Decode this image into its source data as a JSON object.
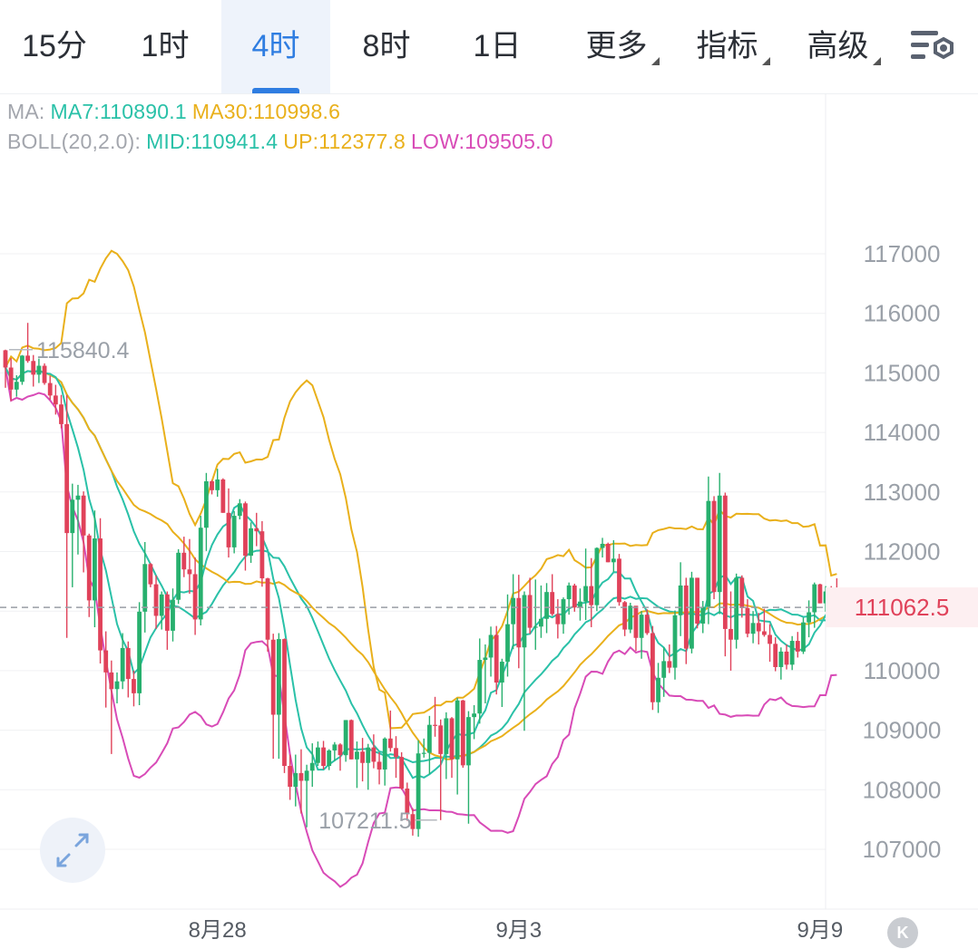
{
  "tabs": [
    {
      "label": "15分",
      "active": false
    },
    {
      "label": "1时",
      "active": false
    },
    {
      "label": "4时",
      "active": true
    },
    {
      "label": "8时",
      "active": false
    },
    {
      "label": "1日",
      "active": false
    },
    {
      "label": "更多",
      "active": false
    },
    {
      "label": "指标",
      "active": false
    },
    {
      "label": "高级",
      "active": false
    }
  ],
  "indicators": {
    "ma_label": "MA:",
    "ma7": "MA7:110890.1",
    "ma30": "MA30:110998.6",
    "boll_label": "BOLL(20,2.0):",
    "boll_mid": "MID:110941.4",
    "boll_up": "UP:112377.8",
    "boll_low": "LOW:109505.0"
  },
  "colors": {
    "up": "#27b06e",
    "down": "#e0425a",
    "ma7": "#2ac1a8",
    "ma30": "#e9b01b",
    "boll_mid": "#2ac1a8",
    "boll_up": "#e9b01b",
    "boll_low": "#d84bb7",
    "price_tag": "#e0425a",
    "axis_text": "#9aa0a8",
    "active_tab": "#2f7de1"
  },
  "chart_data": {
    "type": "candlestick",
    "y_ticks": [
      "117000",
      "116000",
      "115000",
      "114000",
      "113000",
      "112000",
      "111000",
      "110000",
      "109000",
      "108000",
      "107000"
    ],
    "ylim": [
      106300,
      117900
    ],
    "x_ticks": [
      {
        "label": "8月28",
        "index": 38
      },
      {
        "label": "9月3",
        "index": 92
      },
      {
        "label": "9月9",
        "index": 146
      }
    ],
    "current_price": "111062.5",
    "high_marker": {
      "label": "115840.4",
      "index": 0
    },
    "low_marker": {
      "label": "107211.5",
      "index": 78
    },
    "candles": [
      [
        115380,
        115390,
        114750,
        115090
      ],
      [
        115090,
        115250,
        114530,
        114720
      ],
      [
        114720,
        114960,
        114600,
        114850
      ],
      [
        114850,
        115300,
        114800,
        115290
      ],
      [
        115290,
        115840,
        115170,
        115200
      ],
      [
        115200,
        115300,
        114770,
        114970
      ],
      [
        114970,
        115240,
        114830,
        115120
      ],
      [
        115120,
        115160,
        114800,
        114830
      ],
      [
        114830,
        114950,
        114550,
        114620
      ],
      [
        114620,
        114800,
        114300,
        114470
      ],
      [
        114470,
        114630,
        114070,
        114140
      ],
      [
        114140,
        114630,
        110550,
        112310
      ],
      [
        112310,
        113140,
        111400,
        112870
      ],
      [
        112870,
        113120,
        111950,
        112940
      ],
      [
        112940,
        113010,
        111650,
        112270
      ],
      [
        112270,
        112300,
        110900,
        111180
      ],
      [
        111180,
        112690,
        110730,
        112220
      ],
      [
        112220,
        112560,
        110120,
        110340
      ],
      [
        110340,
        110660,
        109380,
        109970
      ],
      [
        109970,
        110170,
        108600,
        109690
      ],
      [
        109690,
        109970,
        109450,
        109820
      ],
      [
        109820,
        110630,
        109690,
        110380
      ],
      [
        110380,
        110490,
        109550,
        109860
      ],
      [
        109860,
        110000,
        109400,
        109620
      ],
      [
        109620,
        111150,
        109420,
        110990
      ],
      [
        110990,
        112160,
        110640,
        111790
      ],
      [
        111790,
        111810,
        111400,
        111450
      ],
      [
        111450,
        111600,
        110700,
        110920
      ],
      [
        110920,
        111330,
        110690,
        111280
      ],
      [
        111280,
        111330,
        110350,
        110670
      ],
      [
        110670,
        111380,
        110490,
        111190
      ],
      [
        111190,
        112040,
        111120,
        111980
      ],
      [
        111980,
        112250,
        111570,
        111700
      ],
      [
        111700,
        112210,
        111290,
        111620
      ],
      [
        111620,
        111900,
        110600,
        110860
      ],
      [
        110860,
        112600,
        110760,
        112400
      ],
      [
        112400,
        113320,
        112010,
        113180
      ],
      [
        113180,
        113200,
        112960,
        113030
      ],
      [
        113030,
        113390,
        112920,
        113210
      ],
      [
        113210,
        113230,
        112650,
        112650
      ],
      [
        112650,
        113060,
        111900,
        112070
      ],
      [
        112070,
        112680,
        111970,
        112600
      ],
      [
        112600,
        112880,
        112540,
        112810
      ],
      [
        112810,
        112840,
        111680,
        111930
      ],
      [
        111930,
        112490,
        111810,
        112390
      ],
      [
        112390,
        112650,
        112090,
        112340
      ],
      [
        112340,
        112510,
        111410,
        111550
      ],
      [
        111550,
        111560,
        110320,
        110520
      ],
      [
        110520,
        110620,
        108520,
        109260
      ],
      [
        109260,
        110630,
        108520,
        110530
      ],
      [
        110530,
        110540,
        108280,
        108400
      ],
      [
        108400,
        108590,
        107830,
        108050
      ],
      [
        108050,
        108590,
        107720,
        108280
      ],
      [
        108280,
        108680,
        107600,
        108150
      ],
      [
        108150,
        108420,
        107370,
        108320
      ],
      [
        108320,
        108780,
        108050,
        108450
      ],
      [
        108450,
        108810,
        108400,
        108710
      ],
      [
        108710,
        108820,
        108340,
        108400
      ],
      [
        108400,
        108680,
        108330,
        108660
      ],
      [
        108660,
        108800,
        108480,
        108760
      ],
      [
        108760,
        108780,
        108320,
        108580
      ],
      [
        108580,
        109170,
        108470,
        109170
      ],
      [
        109170,
        109180,
        108510,
        108510
      ],
      [
        108510,
        108810,
        108030,
        108640
      ],
      [
        108640,
        108870,
        108140,
        108450
      ],
      [
        108450,
        108770,
        108000,
        108710
      ],
      [
        108710,
        108930,
        108360,
        108470
      ],
      [
        108470,
        108630,
        108090,
        108340
      ],
      [
        108340,
        108880,
        108070,
        108860
      ],
      [
        108860,
        109330,
        108640,
        108700
      ],
      [
        108700,
        108900,
        108200,
        108550
      ],
      [
        108550,
        108630,
        108000,
        108020
      ],
      [
        108020,
        108120,
        107480,
        107590
      ],
      [
        107590,
        107690,
        107230,
        107340
      ],
      [
        107340,
        108830,
        107210,
        108610
      ],
      [
        108610,
        108860,
        108540,
        108620
      ],
      [
        108620,
        109240,
        108260,
        109090
      ],
      [
        109090,
        109560,
        108890,
        109080
      ],
      [
        109080,
        109180,
        107490,
        108600
      ],
      [
        108600,
        109300,
        108180,
        109200
      ],
      [
        109200,
        109220,
        108200,
        108510
      ],
      [
        108510,
        109540,
        107920,
        109500
      ],
      [
        109500,
        109510,
        108370,
        108410
      ],
      [
        108410,
        109320,
        107430,
        109220
      ],
      [
        109220,
        109420,
        108850,
        109280
      ],
      [
        109280,
        110540,
        109110,
        110180
      ],
      [
        110180,
        110440,
        109450,
        110220
      ],
      [
        110220,
        110740,
        109900,
        110600
      ],
      [
        110600,
        110750,
        109600,
        109800
      ],
      [
        109800,
        110200,
        109390,
        110150
      ],
      [
        110150,
        111280,
        109900,
        110780
      ],
      [
        110780,
        111620,
        110360,
        111220
      ],
      [
        111220,
        111610,
        110040,
        110390
      ],
      [
        110390,
        111330,
        108990,
        111270
      ],
      [
        111270,
        111560,
        110620,
        110720
      ],
      [
        110720,
        111530,
        110350,
        110740
      ],
      [
        110740,
        111430,
        110550,
        110870
      ],
      [
        110870,
        111470,
        110630,
        111320
      ],
      [
        111320,
        111620,
        110920,
        110950
      ],
      [
        110950,
        111200,
        110540,
        110780
      ],
      [
        110780,
        111230,
        110620,
        111200
      ],
      [
        111200,
        111480,
        110940,
        111430
      ],
      [
        111430,
        111460,
        110990,
        111060
      ],
      [
        111060,
        111380,
        110840,
        111160
      ],
      [
        111160,
        112050,
        110850,
        111420
      ],
      [
        111420,
        111890,
        110730,
        111100
      ],
      [
        111100,
        112070,
        111000,
        112060
      ],
      [
        112060,
        112230,
        111900,
        112130
      ],
      [
        112130,
        112150,
        111820,
        111820
      ],
      [
        111820,
        112190,
        111660,
        111880
      ],
      [
        111880,
        111960,
        111090,
        111150
      ],
      [
        111150,
        111170,
        110580,
        110690
      ],
      [
        110690,
        111140,
        110630,
        111090
      ],
      [
        111090,
        111060,
        110330,
        110550
      ],
      [
        110550,
        111000,
        110200,
        110940
      ],
      [
        110940,
        111030,
        110600,
        110630
      ],
      [
        110630,
        110750,
        109340,
        109470
      ],
      [
        109470,
        110130,
        109290,
        109880
      ],
      [
        109880,
        110390,
        109560,
        110160
      ],
      [
        110160,
        110440,
        109960,
        110050
      ],
      [
        110050,
        111010,
        109850,
        110930
      ],
      [
        110930,
        111820,
        110580,
        111430
      ],
      [
        111430,
        111560,
        110110,
        110370
      ],
      [
        110370,
        111660,
        110290,
        111560
      ],
      [
        111560,
        111560,
        110710,
        110790
      ],
      [
        110790,
        111170,
        110630,
        111070
      ],
      [
        111070,
        113260,
        110780,
        112850
      ],
      [
        112850,
        112930,
        111200,
        111320
      ],
      [
        111320,
        113320,
        110950,
        112940
      ],
      [
        112940,
        112990,
        110240,
        110700
      ],
      [
        110700,
        111330,
        110000,
        110520
      ],
      [
        110520,
        111630,
        110370,
        111560
      ],
      [
        111560,
        111600,
        110890,
        111050
      ],
      [
        111050,
        111200,
        110560,
        110620
      ],
      [
        110620,
        111000,
        110460,
        110800
      ],
      [
        110800,
        110970,
        110440,
        110660
      ],
      [
        110660,
        111040,
        110570,
        110600
      ],
      [
        110600,
        110780,
        110150,
        110450
      ],
      [
        110450,
        110560,
        109990,
        110060
      ],
      [
        110060,
        110390,
        109850,
        110320
      ],
      [
        110320,
        110440,
        110020,
        110100
      ],
      [
        110100,
        110580,
        110010,
        110500
      ],
      [
        110500,
        110650,
        110220,
        110320
      ],
      [
        110320,
        110890,
        110280,
        110810
      ],
      [
        110810,
        111180,
        110560,
        110980
      ],
      [
        110980,
        111480,
        110720,
        111450
      ],
      [
        111450,
        111460,
        111130,
        111130
      ],
      [
        111130,
        111420,
        110990,
        111330
      ],
      [
        111330,
        111420,
        111000,
        111210
      ],
      [
        111210,
        111550,
        110930,
        111060
      ]
    ]
  }
}
